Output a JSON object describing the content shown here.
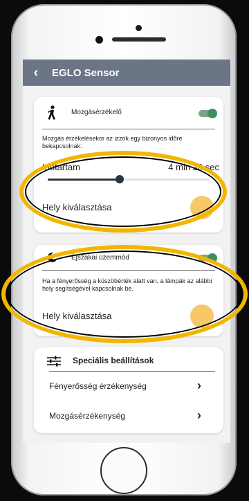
{
  "app": {
    "title": "EGLO Sensor"
  },
  "motion": {
    "label": "Mozgásérzékelő",
    "enabled": true,
    "description": "Mozgás érzékelésekor az izzók egy bizonyos időre bekapcsolnak:",
    "duration_label": "Időtartam",
    "duration_value": "4 min 20 sec",
    "slider_fraction": 0.45,
    "location_label": "Hely kiválasztása"
  },
  "night": {
    "label": "Éjszakai üzemmód",
    "enabled": true,
    "description": "Ha a fényerősség a küszöbérték alatt van, a lámpák az alábbi hely segítségével kapcsolnak be.",
    "location_label": "Hely kiválasztása"
  },
  "special": {
    "title": "Speciális beállítások",
    "items": [
      {
        "label": "Fényerősség érzékenység"
      },
      {
        "label": "Mozgásérzékenység"
      }
    ]
  },
  "colors": {
    "appbar": "#6b7585",
    "toggle": "#3f8f5d",
    "location_swatch": "#f7c86a",
    "highlight": "#f2b600"
  }
}
